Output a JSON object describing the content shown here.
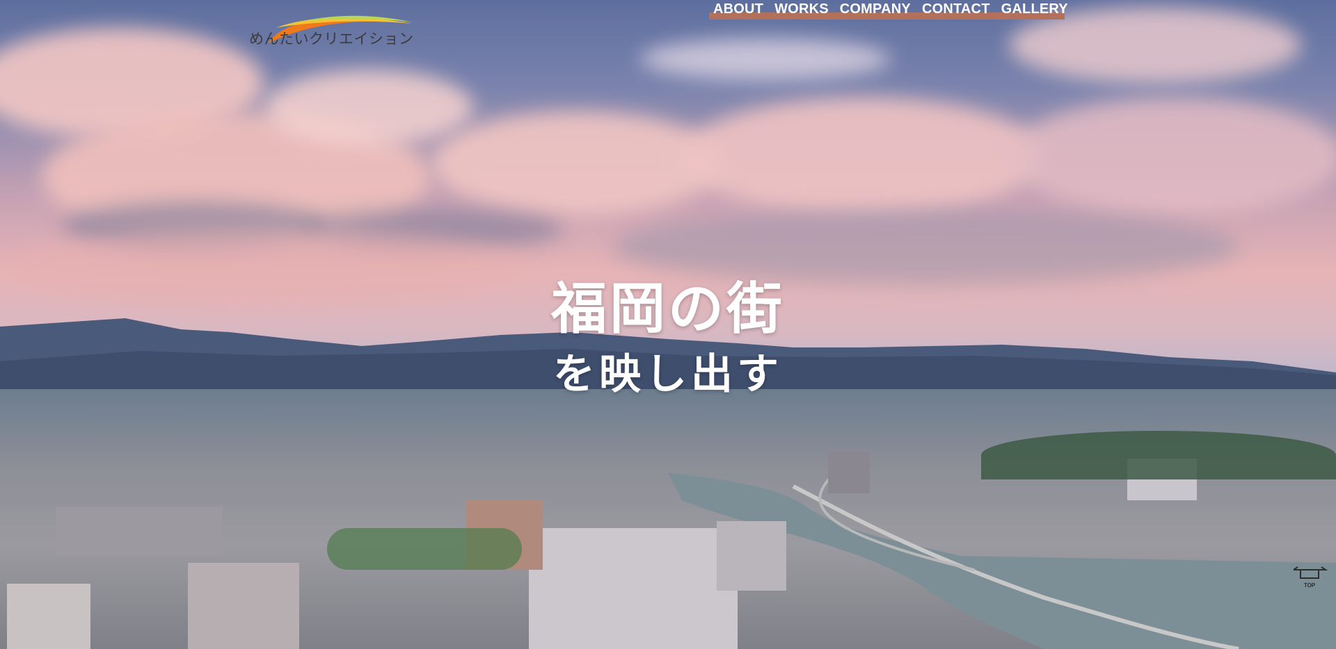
{
  "logo": {
    "text": "めんたいクリエイション",
    "colors": [
      "#f07a1a",
      "#f3c236",
      "#b8d65a"
    ]
  },
  "nav": {
    "items": [
      {
        "label": "ABOUT"
      },
      {
        "label": "WORKS"
      },
      {
        "label": "COMPANY"
      },
      {
        "label": "CONTACT"
      },
      {
        "label": "GALLERY"
      }
    ],
    "underline_color": "#b3705a"
  },
  "hero": {
    "line1": "福岡の街",
    "line2": "を映し出す",
    "background": "aerial-city-photo"
  },
  "top_button": {
    "label": "TOP",
    "icon": "arrow-up-icon"
  }
}
